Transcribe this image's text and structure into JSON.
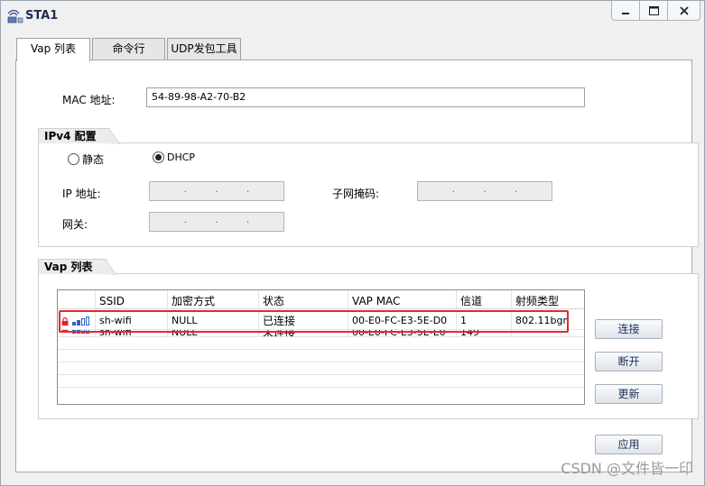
{
  "window": {
    "title": "STA1",
    "controls": {
      "minimize": "minimize-icon",
      "maximize": "maximize-icon",
      "close": "close-icon"
    }
  },
  "tabs": [
    {
      "label": "Vap 列表",
      "active": true
    },
    {
      "label": "命令行",
      "active": false
    },
    {
      "label": "UDP发包工具",
      "active": false
    }
  ],
  "mac": {
    "label": "MAC 地址:",
    "value": "54-89-98-A2-70-B2"
  },
  "ipv4": {
    "group_label": "IPv4 配置",
    "static_label": "静态",
    "dhcp_label": "DHCP",
    "selected": "DHCP",
    "ip_label": "IP 地址:",
    "mask_label": "子网掩码:",
    "gateway_label": "网关:",
    "ip_placeholder": ".   .   .",
    "mask_placeholder": ".   .   .",
    "gateway_placeholder": ".   .   ."
  },
  "vap": {
    "group_label": "Vap 列表",
    "columns": [
      "SSID",
      "加密方式",
      "状态",
      "VAP MAC",
      "信道",
      "射频类型"
    ],
    "rows": [
      {
        "ssid": "sh-wifi",
        "encryption": "NULL",
        "status": "已连接",
        "vap_mac": "00-E0-FC-E3-5E-D0",
        "channel": "1",
        "radio_type": "802.11bgn"
      },
      {
        "ssid": "sh-wifi",
        "encryption": "NULL",
        "status": "未连接",
        "vap_mac": "00-E0-FC-E3-5E-E0",
        "channel": "149",
        "radio_type": ""
      }
    ],
    "buttons": {
      "connect": "连接",
      "disconnect": "断开",
      "refresh": "更新"
    }
  },
  "apply_label": "应用",
  "watermark": "CSDN @文件皆一印",
  "colors": {
    "highlight": "#e8262d",
    "signal": "#2b63c8",
    "lock": "#d8262e"
  }
}
